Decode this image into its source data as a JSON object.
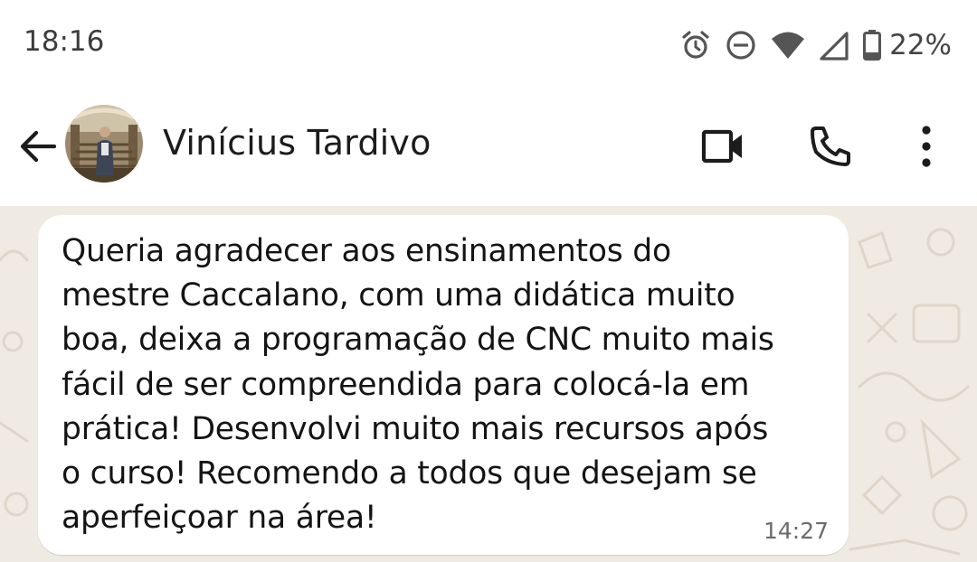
{
  "status_bar": {
    "time": "18:16",
    "battery_percent": "22%",
    "icons": [
      "alarm-icon",
      "do-not-disturb-icon",
      "wifi-icon",
      "cellular-signal-icon",
      "battery-icon"
    ]
  },
  "header": {
    "contact_name": "Vinícius Tardivo",
    "icons": [
      "back-arrow-icon",
      "video-call-icon",
      "phone-icon",
      "more-vert-icon"
    ]
  },
  "message": {
    "lines": [
      "Queria agradecer aos ensinamentos do",
      "mestre Caccalano, com uma didática muito",
      "boa, deixa a programação de CNC muito mais",
      "fácil de ser compreendida para colocá-la em",
      "prática! Desenvolvi muito mais recursos após",
      "o curso! Recomendo a todos que desejam se",
      "aperfeiçoar na área!"
    ],
    "time": "14:27"
  },
  "colors": {
    "chat_background": "#efeae2",
    "bubble": "#ffffff",
    "icon_dark": "#1c1c1c"
  }
}
